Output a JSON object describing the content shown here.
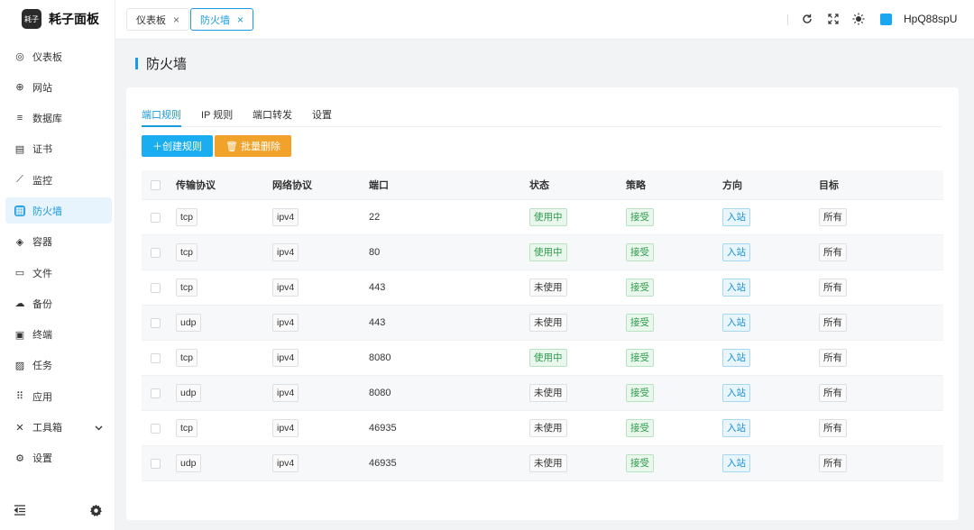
{
  "brand": {
    "logo_text": "耗子",
    "name": "耗子面板"
  },
  "sidebar": {
    "items": [
      {
        "label": "仪表板",
        "icon": "dashboard-icon",
        "glyph": "◎"
      },
      {
        "label": "网站",
        "icon": "globe-icon",
        "glyph": "⊕"
      },
      {
        "label": "数据库",
        "icon": "database-icon",
        "glyph": "≡"
      },
      {
        "label": "证书",
        "icon": "certificate-icon",
        "glyph": "▤"
      },
      {
        "label": "监控",
        "icon": "chart-icon",
        "glyph": "⟋"
      },
      {
        "label": "防火墙",
        "icon": "firewall-icon",
        "glyph": "▦"
      },
      {
        "label": "容器",
        "icon": "container-icon",
        "glyph": "◈"
      },
      {
        "label": "文件",
        "icon": "folder-icon",
        "glyph": "▭"
      },
      {
        "label": "备份",
        "icon": "backup-icon",
        "glyph": "☁"
      },
      {
        "label": "终端",
        "icon": "terminal-icon",
        "glyph": "▣"
      },
      {
        "label": "任务",
        "icon": "task-icon",
        "glyph": "▨"
      },
      {
        "label": "应用",
        "icon": "apps-icon",
        "glyph": "⠿"
      },
      {
        "label": "工具箱",
        "icon": "tools-icon",
        "glyph": "✕"
      },
      {
        "label": "设置",
        "icon": "settings-icon",
        "glyph": "⚙"
      }
    ],
    "active_index": 5
  },
  "header": {
    "tabs": [
      {
        "label": "仪表板",
        "close": "×"
      },
      {
        "label": "防火墙",
        "close": "×"
      }
    ],
    "username": "HpQ88spU"
  },
  "page": {
    "title": "防火墙"
  },
  "subtabs": [
    "端口规则",
    "IP 规则",
    "端口转发",
    "设置"
  ],
  "buttons": {
    "create": "＋创建规则",
    "batch_delete": "🗑 批量删除"
  },
  "table": {
    "columns": [
      "传输协议",
      "网络协议",
      "端口",
      "状态",
      "策略",
      "方向",
      "目标"
    ],
    "rows": [
      {
        "transport": "tcp",
        "network": "ipv4",
        "port": "22",
        "status": "使用中",
        "policy": "接受",
        "direction": "入站",
        "target": "所有"
      },
      {
        "transport": "tcp",
        "network": "ipv4",
        "port": "80",
        "status": "使用中",
        "policy": "接受",
        "direction": "入站",
        "target": "所有"
      },
      {
        "transport": "tcp",
        "network": "ipv4",
        "port": "443",
        "status": "未使用",
        "policy": "接受",
        "direction": "入站",
        "target": "所有"
      },
      {
        "transport": "udp",
        "network": "ipv4",
        "port": "443",
        "status": "未使用",
        "policy": "接受",
        "direction": "入站",
        "target": "所有"
      },
      {
        "transport": "tcp",
        "network": "ipv4",
        "port": "8080",
        "status": "使用中",
        "policy": "接受",
        "direction": "入站",
        "target": "所有"
      },
      {
        "transport": "udp",
        "network": "ipv4",
        "port": "8080",
        "status": "未使用",
        "policy": "接受",
        "direction": "入站",
        "target": "所有"
      },
      {
        "transport": "tcp",
        "network": "ipv4",
        "port": "46935",
        "status": "未使用",
        "policy": "接受",
        "direction": "入站",
        "target": "所有"
      },
      {
        "transport": "udp",
        "network": "ipv4",
        "port": "46935",
        "status": "未使用",
        "policy": "接受",
        "direction": "入站",
        "target": "所有"
      }
    ]
  },
  "colors": {
    "accent": "#1a9be0",
    "warning": "#f0a22a",
    "success": "#2c9a4b",
    "status_swatch": "#1aa6f0"
  }
}
